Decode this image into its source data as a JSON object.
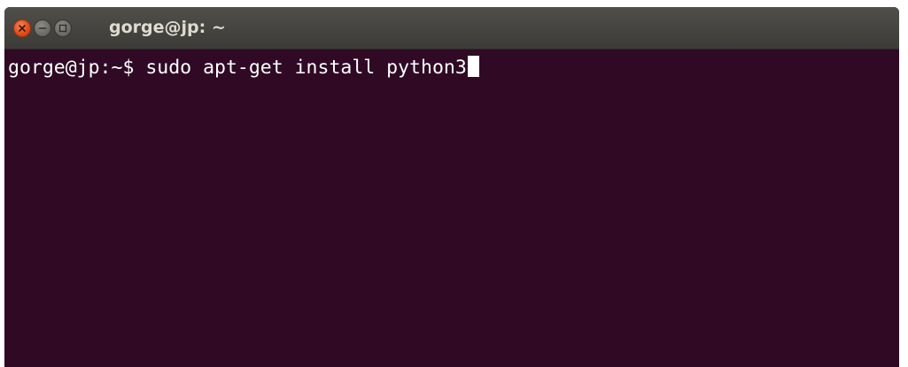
{
  "window": {
    "title": "gorge@jp: ~"
  },
  "titlebar": {
    "buttons": [
      {
        "name": "close",
        "icon": "close-icon",
        "color": "#df4a16"
      },
      {
        "name": "minimize",
        "icon": "minimize-icon",
        "color": "#6a6964"
      },
      {
        "name": "maximize",
        "icon": "maximize-icon",
        "color": "#6a6964"
      }
    ]
  },
  "terminal": {
    "prompt": "gorge@jp:~$",
    "command": "sudo apt-get install python3",
    "background": "#300a24",
    "foreground": "#ffffff"
  }
}
